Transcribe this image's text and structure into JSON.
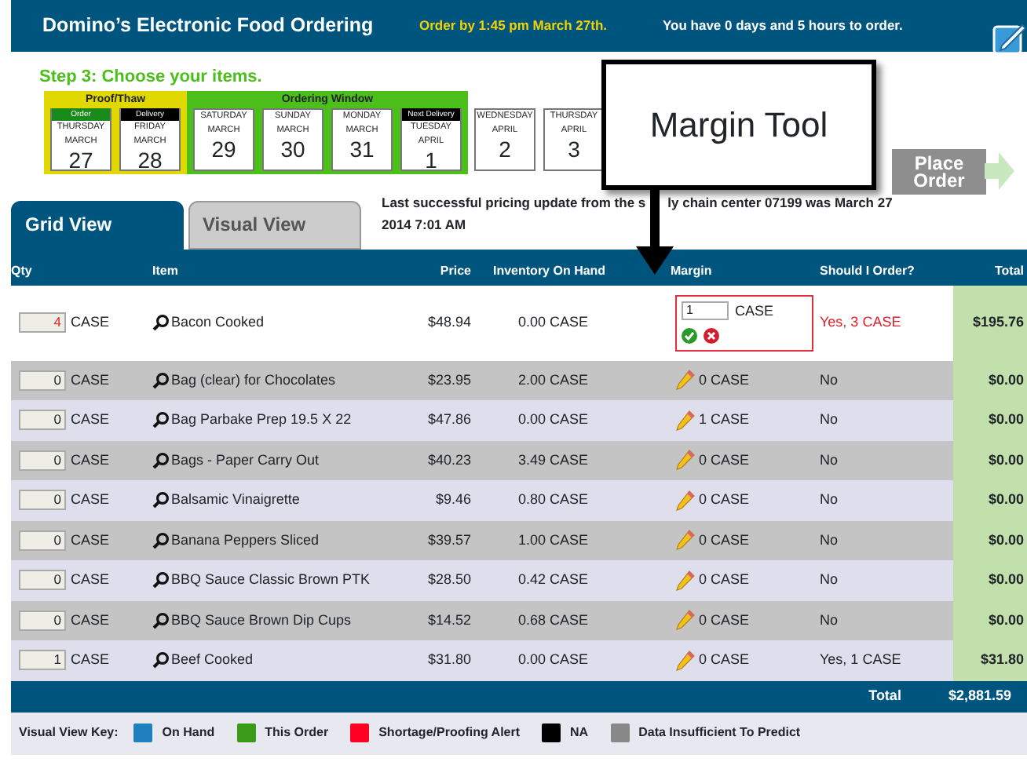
{
  "header": {
    "title": "Domino’s Electronic Food Ordering",
    "deadline": "Order by 1:45 pm March 27th.",
    "countdown": "You have 0 days and 5 hours to order."
  },
  "step": "Step 3: Choose your items.",
  "calendar": [
    {
      "label": "Proof/Thaw",
      "color": "#e0d800",
      "days": [
        {
          "tag": {
            "label": "Order",
            "color": "#1a8a1a"
          },
          "weekday": "THURSDAY",
          "month": "MARCH",
          "day": "27"
        },
        {
          "tag": {
            "label": "Delivery",
            "color": "#000000"
          },
          "weekday": "FRIDAY",
          "month": "MARCH",
          "day": "28"
        }
      ]
    },
    {
      "label": "Ordering Window",
      "color": "#4cbf1a",
      "days": [
        {
          "weekday": "SATURDAY",
          "month": "MARCH",
          "day": "29"
        },
        {
          "weekday": "SUNDAY",
          "month": "MARCH",
          "day": "30"
        },
        {
          "weekday": "MONDAY",
          "month": "MARCH",
          "day": "31"
        },
        {
          "tag": {
            "label": "Next Delivery",
            "color": "#000000"
          },
          "weekday": "TUESDAY",
          "month": "APRIL",
          "day": "1"
        }
      ]
    },
    {
      "days": [
        {
          "weekday": "WEDNESDAY",
          "month": "APRIL",
          "day": "2"
        },
        {
          "weekday": "THURSDAY",
          "month": "APRIL",
          "day": "3"
        }
      ]
    }
  ],
  "place_order": {
    "label": "Place Order",
    "disabled": true
  },
  "callout": "Margin Tool",
  "tabs": [
    {
      "label": "Grid View",
      "selected": true
    },
    {
      "label": "Visual View",
      "selected": false
    }
  ],
  "update_note": [
    "Last successful pricing update from the s",
    "ly chain center 07199 was March 27",
    "2014 7:01 AM"
  ],
  "table": {
    "columns": [
      "Qty",
      "Item",
      "Price",
      "Inventory On Hand",
      "Margin",
      "Should I Order?",
      "Total"
    ],
    "rows": [
      {
        "qty": "4",
        "unit": "CASE",
        "item": "Bacon Cooked",
        "price": "$48.94",
        "inventory": "0.00 CASE",
        "margin": {
          "editing": true,
          "value": "1",
          "unit": "CASE"
        },
        "should_order": "Yes, 3 CASE",
        "alert": true,
        "total": "$195.76"
      },
      {
        "qty": "0",
        "unit": "CASE",
        "item": "Bag (clear) for Chocolates",
        "price": "$23.95",
        "inventory": "2.00 CASE",
        "margin": {
          "editing": false,
          "text": "0 CASE"
        },
        "should_order": "No",
        "alert": false,
        "total": "$0.00"
      },
      {
        "qty": "0",
        "unit": "CASE",
        "item": "Bag Parbake Prep 19.5 X 22",
        "price": "$47.86",
        "inventory": "0.00 CASE",
        "margin": {
          "editing": false,
          "text": "1 CASE"
        },
        "should_order": "No",
        "alert": false,
        "total": "$0.00"
      },
      {
        "qty": "0",
        "unit": "CASE",
        "item": "Bags - Paper Carry Out",
        "price": "$40.23",
        "inventory": "3.49 CASE",
        "margin": {
          "editing": false,
          "text": "0 CASE"
        },
        "should_order": "No",
        "alert": false,
        "total": "$0.00"
      },
      {
        "qty": "0",
        "unit": "CASE",
        "item": "Balsamic Vinaigrette",
        "price": "$9.46",
        "inventory": "0.80 CASE",
        "margin": {
          "editing": false,
          "text": "0 CASE"
        },
        "should_order": "No",
        "alert": false,
        "total": "$0.00"
      },
      {
        "qty": "0",
        "unit": "CASE",
        "item": "Banana Peppers Sliced",
        "price": "$39.57",
        "inventory": "1.00 CASE",
        "margin": {
          "editing": false,
          "text": "0 CASE"
        },
        "should_order": "No",
        "alert": false,
        "total": "$0.00"
      },
      {
        "qty": "0",
        "unit": "CASE",
        "item": "BBQ Sauce Classic Brown PTK",
        "price": "$28.50",
        "inventory": "0.42 CASE",
        "margin": {
          "editing": false,
          "text": "0 CASE"
        },
        "should_order": "No",
        "alert": false,
        "total": "$0.00"
      },
      {
        "qty": "0",
        "unit": "CASE",
        "item": "BBQ Sauce Brown Dip Cups",
        "price": "$14.52",
        "inventory": "0.68 CASE",
        "margin": {
          "editing": false,
          "text": "0 CASE"
        },
        "should_order": "No",
        "alert": false,
        "total": "$0.00"
      },
      {
        "qty": "1",
        "unit": "CASE",
        "item": "Beef Cooked",
        "price": "$31.80",
        "inventory": "0.00 CASE",
        "margin": {
          "editing": false,
          "text": "0 CASE"
        },
        "should_order": "Yes, 1 CASE",
        "alert": false,
        "total": "$31.80"
      }
    ],
    "total_label": "Total",
    "total": "$2,881.59"
  },
  "key": {
    "label": "Visual View Key:",
    "items": [
      {
        "label": "On Hand",
        "color": "#1f7fbf"
      },
      {
        "label": "This Order",
        "color": "#3a9a1a"
      },
      {
        "label": "Shortage/Proofing Alert",
        "color": "#ff0022"
      },
      {
        "label": "NA",
        "color": "#000000"
      },
      {
        "label": "Data Insufficient To Predict",
        "color": "#888888"
      }
    ]
  }
}
